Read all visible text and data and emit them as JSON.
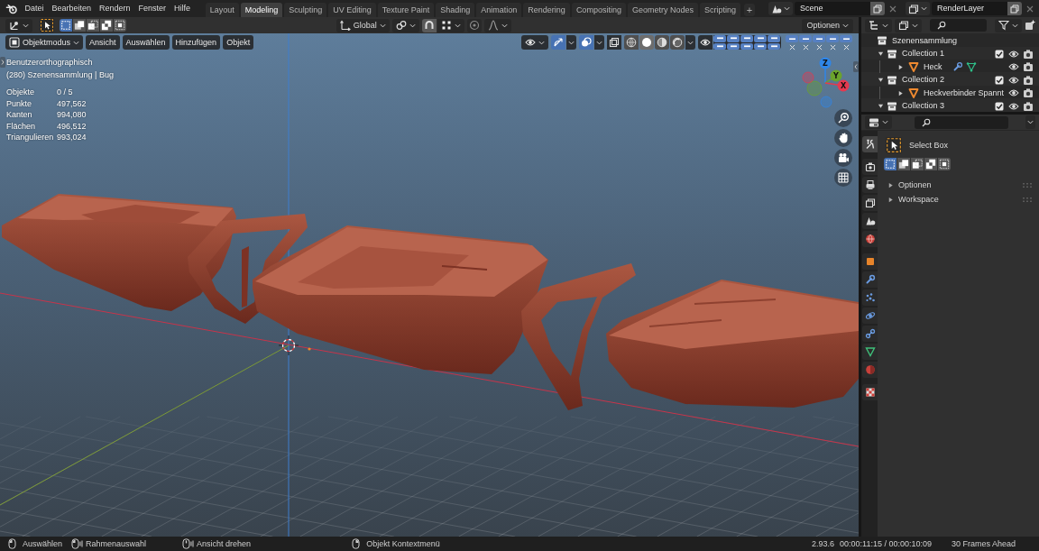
{
  "top_bar": {
    "menus": [
      "Datei",
      "Bearbeiten",
      "Rendern",
      "Fenster",
      "Hilfe"
    ],
    "workspaces": [
      {
        "label": "Layout",
        "selected": false
      },
      {
        "label": "Modeling",
        "selected": true
      },
      {
        "label": "Sculpting",
        "selected": false
      },
      {
        "label": "UV Editing",
        "selected": false
      },
      {
        "label": "Texture Paint",
        "selected": false
      },
      {
        "label": "Shading",
        "selected": false
      },
      {
        "label": "Animation",
        "selected": false
      },
      {
        "label": "Rendering",
        "selected": false
      },
      {
        "label": "Compositing",
        "selected": false
      },
      {
        "label": "Geometry Nodes",
        "selected": false
      },
      {
        "label": "Scripting",
        "selected": false
      }
    ],
    "add_tab": "+",
    "scene": "Scene",
    "view_layer": "RenderLayer"
  },
  "tool_header": {
    "select_modes": [
      {
        "kind": "set",
        "selected": true
      },
      {
        "kind": "extend",
        "selected": false
      },
      {
        "kind": "subtract",
        "selected": false
      },
      {
        "kind": "difference",
        "selected": false
      },
      {
        "kind": "intersect",
        "selected": false
      }
    ],
    "orientation": "Global",
    "options": "Optionen"
  },
  "viewport": {
    "mode": "Objektmodus",
    "menus": [
      "Ansicht",
      "Auswählen",
      "Hinzufügen",
      "Objekt"
    ],
    "toggles": [
      {
        "kind": "gizmos",
        "on": true
      },
      {
        "kind": "overlays",
        "on": true
      },
      {
        "kind": "xray",
        "on": false
      }
    ],
    "shading": [
      {
        "kind": "wireframe",
        "selected": false
      },
      {
        "kind": "solid",
        "selected": true
      },
      {
        "kind": "material",
        "selected": false
      },
      {
        "kind": "rendered",
        "selected": false
      }
    ],
    "collection_toggles": [
      {
        "on": true
      },
      {
        "on": true
      },
      {
        "on": true
      },
      {
        "on": true
      },
      {
        "on": true
      },
      {
        "on": true
      },
      {
        "on": true
      },
      {
        "on": true
      },
      {
        "on": true
      },
      {
        "on": true
      }
    ],
    "collection_toggles_2": [
      {
        "on": true
      },
      {
        "on": true
      },
      {
        "on": true
      },
      {
        "on": true
      },
      {
        "on": true
      }
    ],
    "info": {
      "view": "Benutzerorthographisch",
      "context": "(280) Szenensammlung | Bug",
      "stats": [
        {
          "label": "Objekte",
          "value": "0 / 5"
        },
        {
          "label": "Punkte",
          "value": "497,562"
        },
        {
          "label": "Kanten",
          "value": "994,080"
        },
        {
          "label": "Flächen",
          "value": "496,512"
        },
        {
          "label": "Triangulieren",
          "value": "993,024"
        }
      ]
    },
    "axes": [
      {
        "kind": "z",
        "label": "Z",
        "color": "#2f86e8"
      },
      {
        "kind": "y",
        "label": "Y",
        "color": "#6ba32c"
      },
      {
        "kind": "x",
        "label": "X",
        "color": "#e6394f"
      }
    ]
  },
  "outliner": {
    "root": "Szenensammlung",
    "collections": [
      {
        "label": "Collection 1",
        "expanded": true,
        "checked": true,
        "children": [
          {
            "label": "Heck",
            "expanded": false,
            "modifier_icons": true
          }
        ]
      },
      {
        "label": "Collection 2",
        "expanded": true,
        "checked": true,
        "children": [
          {
            "label": "Heckverbinder Spannt",
            "expanded": false,
            "modifier_icons": false
          }
        ]
      },
      {
        "label": "Collection 3",
        "expanded": true,
        "checked": true
      }
    ]
  },
  "properties": {
    "tabs": [
      {
        "kind": "tool",
        "selected": true
      },
      {
        "kind": "render",
        "selected": false
      },
      {
        "kind": "output",
        "selected": false
      },
      {
        "kind": "view_layer",
        "selected": false
      },
      {
        "kind": "scene",
        "selected": false
      },
      {
        "kind": "world",
        "selected": false
      },
      {
        "kind": "object",
        "selected": false
      },
      {
        "kind": "modifier",
        "selected": false
      },
      {
        "kind": "particles",
        "selected": false
      },
      {
        "kind": "physics",
        "selected": false
      },
      {
        "kind": "constraints",
        "selected": false
      },
      {
        "kind": "data",
        "selected": false
      },
      {
        "kind": "material",
        "selected": false
      },
      {
        "kind": "texture",
        "selected": false
      }
    ],
    "tool": "Select Box",
    "select_modes": [
      {
        "kind": "set",
        "selected": true
      },
      {
        "kind": "extend",
        "selected": false
      },
      {
        "kind": "subtract",
        "selected": false
      },
      {
        "kind": "difference",
        "selected": false
      },
      {
        "kind": "intersect",
        "selected": false
      }
    ],
    "panels": [
      {
        "label": "Optionen",
        "expanded": false
      },
      {
        "label": "Workspace",
        "expanded": false
      }
    ]
  },
  "status_bar": {
    "hints": [
      {
        "kind": "left-click",
        "label": "Auswählen"
      },
      {
        "kind": "left-drag",
        "label": "Rahmenauswahl"
      },
      {
        "kind": "middle-drag",
        "label": "Ansicht drehen"
      },
      {
        "kind": "right-click",
        "label": "Objekt Kontextmenü"
      }
    ],
    "version": "2.93.6",
    "time": "00:00:11:15 / 00:00:10:09",
    "message": "30 Frames Ahead"
  }
}
